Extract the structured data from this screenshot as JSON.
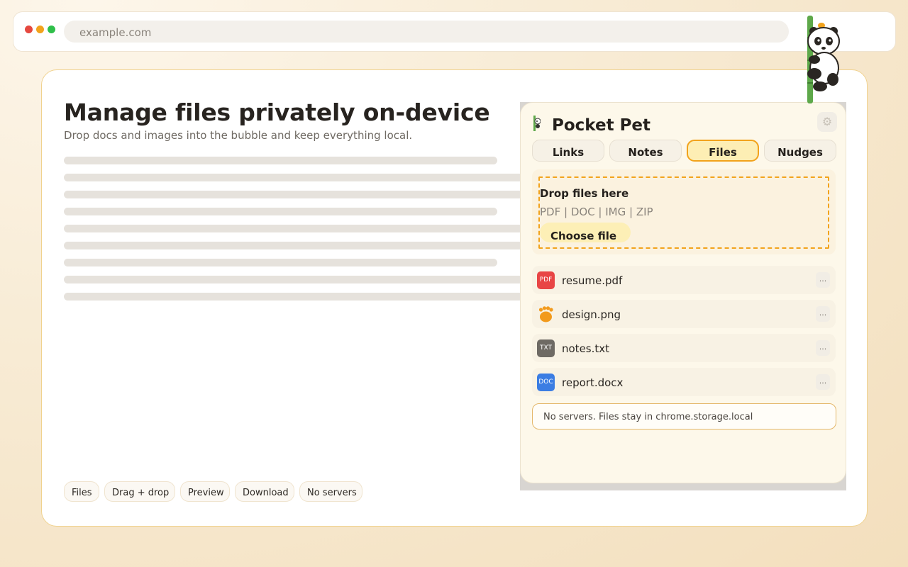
{
  "browser": {
    "url": "example.com"
  },
  "page": {
    "title": "Manage files privately on-device",
    "subtitle": "Drop docs and images into the bubble and keep everything local.",
    "chips": [
      "Files",
      "Drag + drop",
      "Preview",
      "Download",
      "No servers"
    ]
  },
  "popup": {
    "title": "Pocket Pet",
    "tabs": [
      {
        "label": "Links",
        "active": false
      },
      {
        "label": "Notes",
        "active": false
      },
      {
        "label": "Files",
        "active": true
      },
      {
        "label": "Nudges",
        "active": false
      }
    ],
    "dropzone": {
      "title": "Drop files here",
      "formats": "PDF | DOC | IMG | ZIP",
      "button": "Choose file"
    },
    "files": [
      {
        "name": "resume.pdf",
        "icon_label": "PDF",
        "icon": "pdf-file-icon",
        "color": "#e84545"
      },
      {
        "name": "design.png",
        "icon_label": "",
        "icon": "paw-image-icon",
        "color": "#f29a1c"
      },
      {
        "name": "notes.txt",
        "icon_label": "TXT",
        "icon": "txt-file-icon",
        "color": "#6e6a64"
      },
      {
        "name": "report.docx",
        "icon_label": "DOC",
        "icon": "doc-file-icon",
        "color": "#3b7de3"
      }
    ],
    "more_label": "...",
    "footer_note": "No servers. Files stay in chrome.storage.local"
  },
  "colors": {
    "accent": "#f2a31c",
    "card_border": "#f0d28e",
    "popup_bg": "#fdf8ea"
  }
}
